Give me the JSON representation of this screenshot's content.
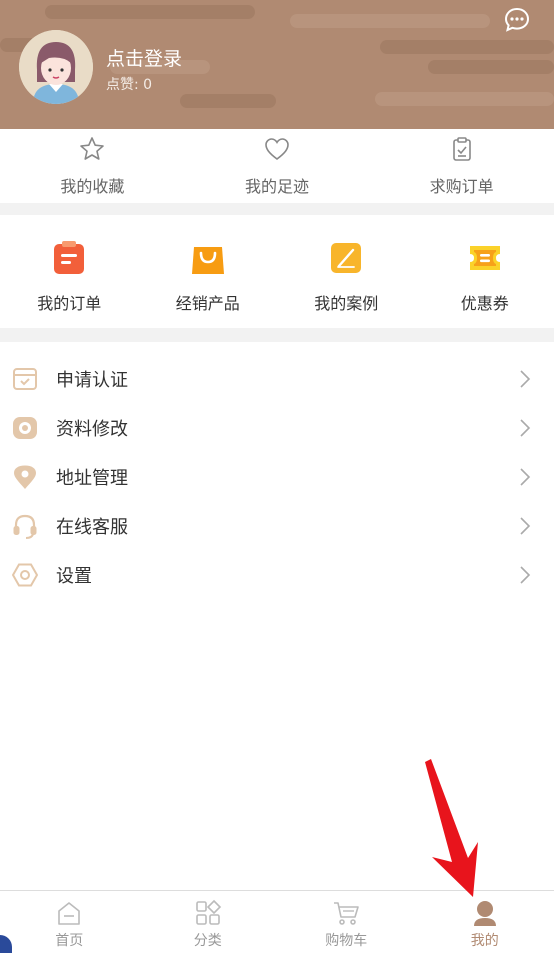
{
  "colors": {
    "header_bg": "#b08a72",
    "accent": "#b08a72",
    "arrow": "#e8141c"
  },
  "header": {
    "login_label": "点击登录",
    "likes_label": "点赞: 0",
    "chat_icon": "chat-bubble-icon",
    "avatar_icon": "user-avatar-icon"
  },
  "quick": [
    {
      "label": "我的收藏",
      "icon": "star-icon"
    },
    {
      "label": "我的足迹",
      "icon": "heart-icon"
    },
    {
      "label": "求购订单",
      "icon": "clipboard-check-icon"
    }
  ],
  "features": [
    {
      "label": "我的订单",
      "icon": "order-clipboard-icon"
    },
    {
      "label": "经销产品",
      "icon": "shopping-bag-icon"
    },
    {
      "label": "我的案例",
      "icon": "edit-note-icon"
    },
    {
      "label": "优惠券",
      "icon": "coupon-icon"
    }
  ],
  "menu": [
    {
      "label": "申请认证",
      "icon": "certify-icon"
    },
    {
      "label": "资料修改",
      "icon": "profile-edit-icon"
    },
    {
      "label": "地址管理",
      "icon": "location-pin-icon"
    },
    {
      "label": "在线客服",
      "icon": "headset-icon"
    },
    {
      "label": "设置",
      "icon": "settings-icon"
    }
  ],
  "tabs": [
    {
      "label": "首页",
      "icon": "home-icon",
      "active": false
    },
    {
      "label": "分类",
      "icon": "category-grid-icon",
      "active": false
    },
    {
      "label": "购物车",
      "icon": "cart-icon",
      "active": false
    },
    {
      "label": "我的",
      "icon": "person-icon",
      "active": true
    }
  ]
}
